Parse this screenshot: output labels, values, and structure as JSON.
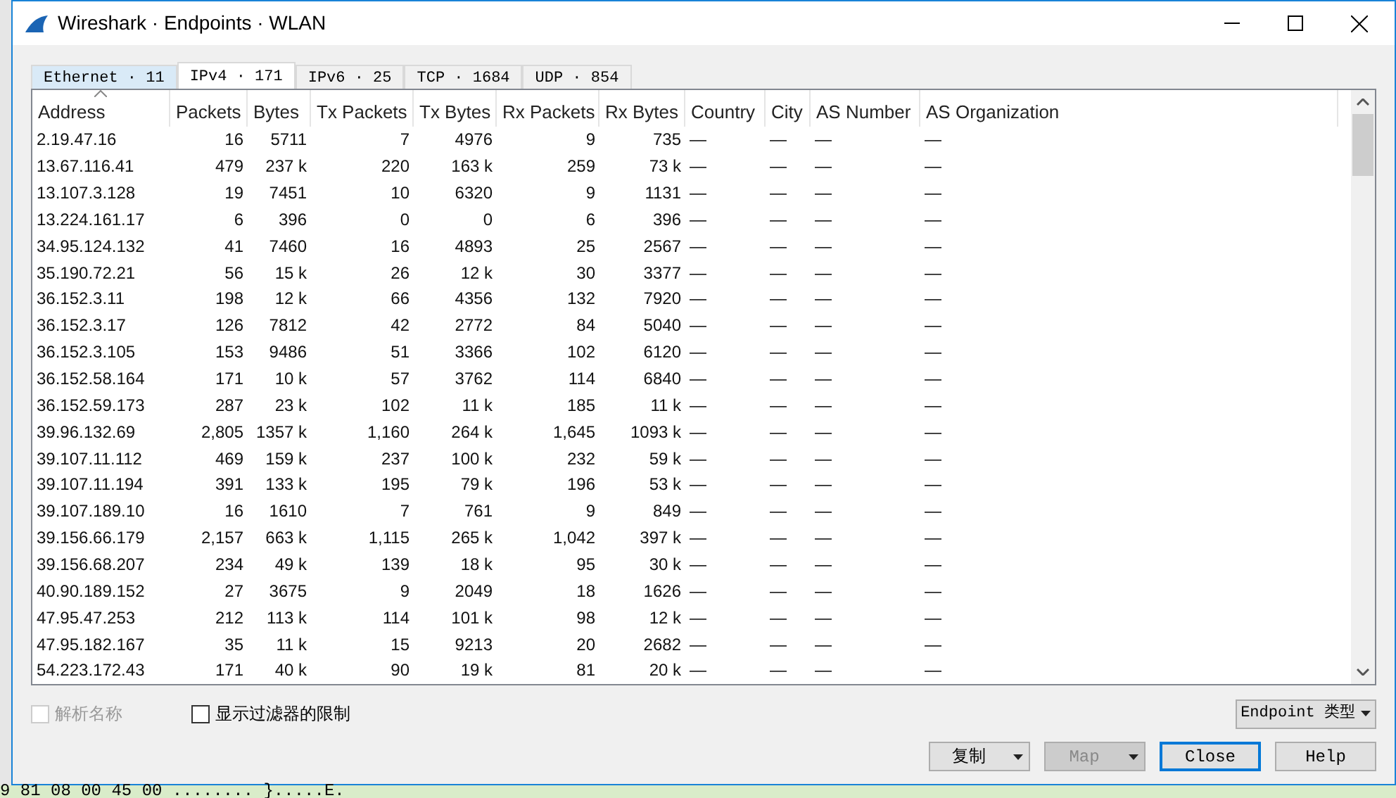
{
  "window": {
    "title": "Wireshark · Endpoints · WLAN"
  },
  "tabs": [
    {
      "label": "Ethernet · 11",
      "selected": false
    },
    {
      "label": "IPv4 · 171",
      "selected": true
    },
    {
      "label": "IPv6 · 25",
      "selected": false
    },
    {
      "label": "TCP · 1684",
      "selected": false
    },
    {
      "label": "UDP · 854",
      "selected": false
    }
  ],
  "table": {
    "columns": [
      "Address",
      "Packets",
      "Bytes",
      "Tx Packets",
      "Tx Bytes",
      "Rx Packets",
      "Rx Bytes",
      "Country",
      "City",
      "AS Number",
      "AS Organization"
    ],
    "rows": [
      [
        "2.19.47.16",
        "16",
        "5711",
        "7",
        "4976",
        "9",
        "735",
        "—",
        "—",
        "—",
        "—"
      ],
      [
        "13.67.116.41",
        "479",
        "237 k",
        "220",
        "163 k",
        "259",
        "73 k",
        "—",
        "—",
        "—",
        "—"
      ],
      [
        "13.107.3.128",
        "19",
        "7451",
        "10",
        "6320",
        "9",
        "1131",
        "—",
        "—",
        "—",
        "—"
      ],
      [
        "13.224.161.17",
        "6",
        "396",
        "0",
        "0",
        "6",
        "396",
        "—",
        "—",
        "—",
        "—"
      ],
      [
        "34.95.124.132",
        "41",
        "7460",
        "16",
        "4893",
        "25",
        "2567",
        "—",
        "—",
        "—",
        "—"
      ],
      [
        "35.190.72.21",
        "56",
        "15 k",
        "26",
        "12 k",
        "30",
        "3377",
        "—",
        "—",
        "—",
        "—"
      ],
      [
        "36.152.3.11",
        "198",
        "12 k",
        "66",
        "4356",
        "132",
        "7920",
        "—",
        "—",
        "—",
        "—"
      ],
      [
        "36.152.3.17",
        "126",
        "7812",
        "42",
        "2772",
        "84",
        "5040",
        "—",
        "—",
        "—",
        "—"
      ],
      [
        "36.152.3.105",
        "153",
        "9486",
        "51",
        "3366",
        "102",
        "6120",
        "—",
        "—",
        "—",
        "—"
      ],
      [
        "36.152.58.164",
        "171",
        "10 k",
        "57",
        "3762",
        "114",
        "6840",
        "—",
        "—",
        "—",
        "—"
      ],
      [
        "36.152.59.173",
        "287",
        "23 k",
        "102",
        "11 k",
        "185",
        "11 k",
        "—",
        "—",
        "—",
        "—"
      ],
      [
        "39.96.132.69",
        "2,805",
        "1357 k",
        "1,160",
        "264 k",
        "1,645",
        "1093 k",
        "—",
        "—",
        "—",
        "—"
      ],
      [
        "39.107.11.112",
        "469",
        "159 k",
        "237",
        "100 k",
        "232",
        "59 k",
        "—",
        "—",
        "—",
        "—"
      ],
      [
        "39.107.11.194",
        "391",
        "133 k",
        "195",
        "79 k",
        "196",
        "53 k",
        "—",
        "—",
        "—",
        "—"
      ],
      [
        "39.107.189.10",
        "16",
        "1610",
        "7",
        "761",
        "9",
        "849",
        "—",
        "—",
        "—",
        "—"
      ],
      [
        "39.156.66.179",
        "2,157",
        "663 k",
        "1,115",
        "265 k",
        "1,042",
        "397 k",
        "—",
        "—",
        "—",
        "—"
      ],
      [
        "39.156.68.207",
        "234",
        "49 k",
        "139",
        "18 k",
        "95",
        "30 k",
        "—",
        "—",
        "—",
        "—"
      ],
      [
        "40.90.189.152",
        "27",
        "3675",
        "9",
        "2049",
        "18",
        "1626",
        "—",
        "—",
        "—",
        "—"
      ],
      [
        "47.95.47.253",
        "212",
        "113 k",
        "114",
        "101 k",
        "98",
        "12 k",
        "—",
        "—",
        "—",
        "—"
      ],
      [
        "47.95.182.167",
        "35",
        "11 k",
        "15",
        "9213",
        "20",
        "2682",
        "—",
        "—",
        "—",
        "—"
      ],
      [
        "54.223.172.43",
        "171",
        "40 k",
        "90",
        "19 k",
        "81",
        "20 k",
        "—",
        "—",
        "—",
        "—"
      ]
    ]
  },
  "options": [
    {
      "label": "解析名称",
      "checked": false,
      "disabled": true
    },
    {
      "label": "显示过滤器的限制",
      "checked": false,
      "disabled": false
    }
  ],
  "endpoint_type": {
    "label": "Endpoint 类型"
  },
  "buttons": [
    {
      "label": "复制",
      "kind": "menu",
      "disabled": false,
      "default": false
    },
    {
      "label": "Map",
      "kind": "menu",
      "disabled": true,
      "default": false
    },
    {
      "label": "Close",
      "kind": "plain",
      "disabled": false,
      "default": true
    },
    {
      "label": "Help",
      "kind": "plain",
      "disabled": false,
      "default": false
    }
  ],
  "background_text": "9 81 08 00 45 00 ........ }.....E."
}
